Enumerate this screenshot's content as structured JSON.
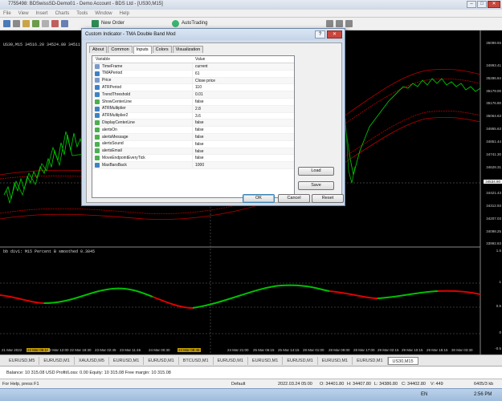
{
  "window": {
    "title": "7755498: BDSwissSD-Demo01 - Demo Account - BDS Ltd - [US30,M15]",
    "min": "–",
    "max": "□",
    "close": "✕"
  },
  "menu": [
    "File",
    "View",
    "Insert",
    "Charts",
    "Tools",
    "Window",
    "Help"
  ],
  "toolbar": {
    "new_order": "New Order",
    "autotrading": "AutoTrading"
  },
  "chart": {
    "header": "US30,M15  34516.20 34524.80 34511.20 34518.00",
    "indicator_label": "bb div1: M15  Percent B smoothed 0.3845",
    "price_labels": [
      "35099.93",
      "34993.41",
      "35286.84",
      "35179.00",
      "35176.80",
      "35064.63",
      "34955.63",
      "34851.44",
      "34741.30",
      "34628.31",
      "34534.80",
      "34421.43",
      "34312.93",
      "34207.03",
      "34098.25",
      "33992.63"
    ],
    "current_price": "34534.80",
    "sub_labels": [
      "1.5",
      "1",
      "0.5",
      "0",
      "-0.5"
    ],
    "time_labels": [
      "21 Mar 2022",
      "22 Mar 05:15",
      "22 Mar 12:00",
      "22 Mar 18:30",
      "23 Mar 02:45",
      "23 Mar 11:45",
      "24 Mar 00:30",
      "24 Mar 08:45",
      "24 Mar 21:00",
      "25 Mar 06:15",
      "25 Mar 14:15",
      "28 Mar 01:00",
      "28 Mar 09:00",
      "28 Mar 17:00",
      "29 Mar 02:15",
      "29 Mar 10:15",
      "29 Mar 18:15",
      "30 Mar 03:30",
      "30 Mar 11:30"
    ],
    "highlight_time": "24 Mar 08:45"
  },
  "symbol_tabs": [
    "EURUSD,M5",
    "EURUSD,M1",
    "XAUUSD,M5",
    "EURUSD,M1",
    "EURUSD,M1",
    "BTCUSD,M1",
    "EURUSD,M1",
    "EURUSD,M1",
    "EURUSD,M1",
    "EURUSD,M1",
    "EURUSD,M1",
    "US30,M15"
  ],
  "balance_text": "Balance: 10 315.08 USD  Profit/Loss: 0.00  Equity: 10 315.08  Free margin: 10 315.08",
  "status": {
    "help": "For Help, press F1",
    "profile": "Default",
    "datetime": "2022.03.24 05:00",
    "open": "O: 34401.80",
    "high": "H: 34407.80",
    "low": "L: 34386.80",
    "close": "C: 34402.80",
    "volume": "V: 449",
    "traffic": "6405/3 kb"
  },
  "taskbar": {
    "lang": "EN",
    "time": "2:56 PM"
  },
  "dialog": {
    "title": "Custom Indicator - TMA Double Band Mod",
    "help": "?",
    "tabs": [
      "About",
      "Common",
      "Inputs",
      "Colors",
      "Visualization"
    ],
    "active_tab": "Inputs",
    "col_variable": "Variable",
    "col_value": "Value",
    "params": [
      {
        "name": "TimeFrame",
        "value": "current",
        "type": "str"
      },
      {
        "name": "TMAPeriod",
        "value": "61",
        "type": "num"
      },
      {
        "name": "Price",
        "value": "Close price",
        "type": "str"
      },
      {
        "name": "ATRPeriod",
        "value": "110",
        "type": "num"
      },
      {
        "name": "TrendThreshold",
        "value": "0.01",
        "type": "num"
      },
      {
        "name": "ShowCenterLine",
        "value": "false",
        "type": "bool"
      },
      {
        "name": "ATRMultiplier",
        "value": "2.8",
        "type": "num"
      },
      {
        "name": "ATRMultiplier2",
        "value": "3.6",
        "type": "num"
      },
      {
        "name": "DisplayCenterLine",
        "value": "false",
        "type": "bool"
      },
      {
        "name": "alertsOn",
        "value": "false",
        "type": "bool"
      },
      {
        "name": "alertsMessage",
        "value": "false",
        "type": "bool"
      },
      {
        "name": "alertsSound",
        "value": "false",
        "type": "bool"
      },
      {
        "name": "alertsEmail",
        "value": "false",
        "type": "bool"
      },
      {
        "name": "MoveEndpointEveryTick",
        "value": "false",
        "type": "bool"
      },
      {
        "name": "MaxBarsBack",
        "value": "1000",
        "type": "num"
      }
    ],
    "buttons": {
      "load": "Load",
      "save": "Save",
      "ok": "OK",
      "cancel": "Cancel",
      "reset": "Reset"
    }
  }
}
